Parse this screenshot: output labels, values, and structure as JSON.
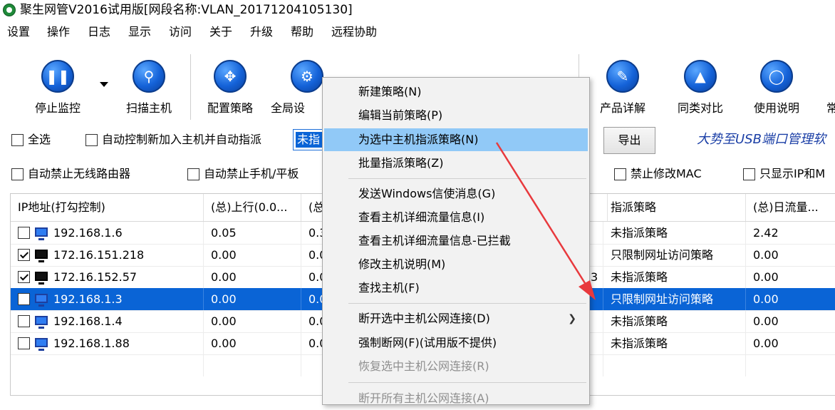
{
  "window": {
    "title": "聚生网管V2016试用版[网段名称:VLAN_20171204105130]"
  },
  "menu": [
    "设置",
    "操作",
    "日志",
    "显示",
    "访问",
    "关于",
    "升级",
    "帮助",
    "远程协助"
  ],
  "toolbar": {
    "stop_monitor": "停止监控",
    "scan_host": "扫描主机",
    "config_policy": "配置策略",
    "global_settings": "全局设",
    "product_detail": "产品详解",
    "compare": "同类对比",
    "manual": "使用说明",
    "more_partial": "常"
  },
  "options": {
    "select_all": "全选",
    "auto_control": "自动控制新加入主机并自动指派",
    "combo_value": "未指",
    "export": "导出",
    "banner": "大势至USB端口管理软",
    "block_wireless_router": "自动禁止无线路由器",
    "block_phone_tablet": "自动禁止手机/平板",
    "block_change_mac": "禁止修改MAC",
    "show_ip_only": "只显示IP和M"
  },
  "grid": {
    "headers": {
      "ip": "IP地址(打勾控制)",
      "upload": "(总)上行(0.0...",
      "download": "(总",
      "policy": "指派策略",
      "daily": "(总)日流量..."
    },
    "rows": [
      {
        "ip": "192.168.1.6",
        "checked": false,
        "dark": false,
        "up": "0.05",
        "down": "0.3",
        "extra": "",
        "policy": "未指派策略",
        "daily": "2.42",
        "selected": false
      },
      {
        "ip": "172.16.151.218",
        "checked": true,
        "dark": true,
        "up": "0.00",
        "down": "0.0",
        "extra": "",
        "policy": "只限制网址访问策略",
        "daily": "0.00",
        "selected": false
      },
      {
        "ip": "172.16.152.57",
        "checked": true,
        "dark": true,
        "up": "0.00",
        "down": "0.0",
        "extra": "3",
        "policy": "未指派策略",
        "daily": "0.00",
        "selected": false
      },
      {
        "ip": "192.168.1.3",
        "checked": false,
        "dark": false,
        "up": "0.00",
        "down": "0.0",
        "extra": "",
        "policy": "只限制网址访问策略",
        "daily": "0.00",
        "selected": true
      },
      {
        "ip": "192.168.1.4",
        "checked": false,
        "dark": false,
        "up": "0.00",
        "down": "0.0",
        "extra": "",
        "policy": "未指派策略",
        "daily": "0.00",
        "selected": false
      },
      {
        "ip": "192.168.1.88",
        "checked": false,
        "dark": false,
        "up": "0.00",
        "down": "0.0",
        "extra": "",
        "policy": "未指派策略",
        "daily": "0.00",
        "selected": false
      }
    ]
  },
  "context_menu": {
    "new_policy": "新建策略(N)",
    "edit_policy": "编辑当前策略(P)",
    "assign_policy": "为选中主机指派策略(N)",
    "batch_assign": "批量指派策略(Z)",
    "send_message": "发送Windows信使消息(G)",
    "view_traffic": "查看主机详细流量信息(I)",
    "view_traffic_blocked": "查看主机详细流量信息-已拦截",
    "edit_description": "修改主机说明(M)",
    "find_host": "查找主机(F)",
    "disconnect_selected": "断开选中主机公网连接(D)",
    "force_disconnect": "强制断网(F)(试用版不提供)",
    "restore_selected": "恢复选中主机公网连接(R)",
    "disconnect_all_partial": "断开所有主机公网连接(A)"
  },
  "colors": {
    "selection": "#0a64d6",
    "menu_highlight": "#91c9f7",
    "annotation_arrow": "#e8393d",
    "banner_text": "#1b3fa6"
  }
}
